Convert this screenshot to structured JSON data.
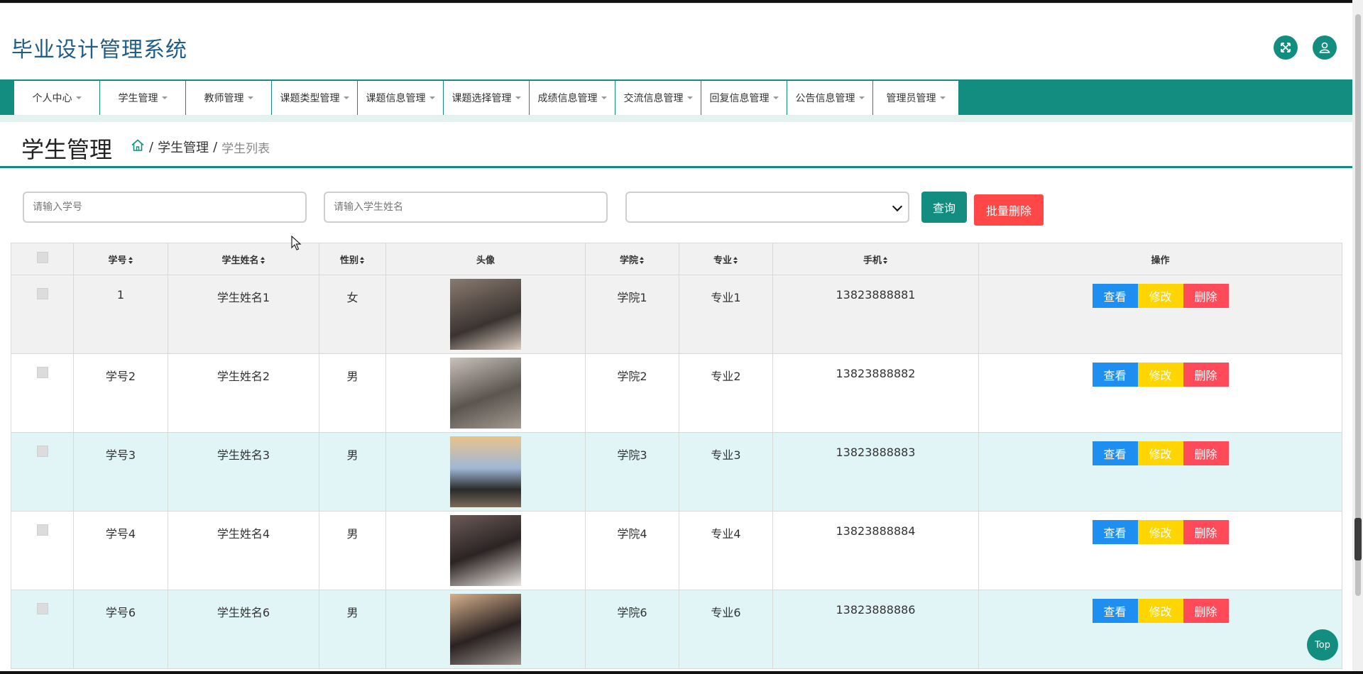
{
  "app": {
    "title": "毕业设计管理系统"
  },
  "header": {
    "fullscreen_icon": "fullscreen-icon",
    "user_icon": "user-icon",
    "accent": "#138d80",
    "title_color": "#1f5d8a"
  },
  "nav": {
    "items": [
      {
        "label": "个人中心"
      },
      {
        "label": "学生管理"
      },
      {
        "label": "教师管理"
      },
      {
        "label": "课题类型管理"
      },
      {
        "label": "课题信息管理"
      },
      {
        "label": "课题选择管理"
      },
      {
        "label": "成绩信息管理"
      },
      {
        "label": "交流信息管理"
      },
      {
        "label": "回复信息管理"
      },
      {
        "label": "公告信息管理"
      },
      {
        "label": "管理员管理"
      }
    ]
  },
  "page": {
    "title": "学生管理",
    "breadcrumb": {
      "home_icon": "home-icon",
      "section": "学生管理",
      "current": "学生列表",
      "separator": "/"
    }
  },
  "search": {
    "student_no_placeholder": "请输入学号",
    "student_name_placeholder": "请输入学生姓名",
    "select_value": "",
    "query_label": "查询",
    "batch_delete_label": "批量删除"
  },
  "table": {
    "headers": {
      "student_no": "学号",
      "name": "学生姓名",
      "gender": "性别",
      "avatar": "头像",
      "college": "学院",
      "major": "专业",
      "phone": "手机",
      "actions": "操作"
    },
    "action_labels": {
      "view": "查看",
      "edit": "修改",
      "delete": "删除"
    },
    "rows": [
      {
        "student_no": "1",
        "name": "学生姓名1",
        "gender": "女",
        "college": "学院1",
        "major": "专业1",
        "phone": "13823888881"
      },
      {
        "student_no": "学号2",
        "name": "学生姓名2",
        "gender": "男",
        "college": "学院2",
        "major": "专业2",
        "phone": "13823888882"
      },
      {
        "student_no": "学号3",
        "name": "学生姓名3",
        "gender": "男",
        "college": "学院3",
        "major": "专业3",
        "phone": "13823888883"
      },
      {
        "student_no": "学号4",
        "name": "学生姓名4",
        "gender": "男",
        "college": "学院4",
        "major": "专业4",
        "phone": "13823888884"
      },
      {
        "student_no": "学号6",
        "name": "学生姓名6",
        "gender": "男",
        "college": "学院6",
        "major": "专业6",
        "phone": "13823888886"
      }
    ]
  },
  "back_to_top": {
    "label": "Top"
  },
  "colors": {
    "view": "#1e8ff0",
    "edit": "#ffd500",
    "delete": "#ff4a5a",
    "batch_delete": "#ff4747"
  }
}
